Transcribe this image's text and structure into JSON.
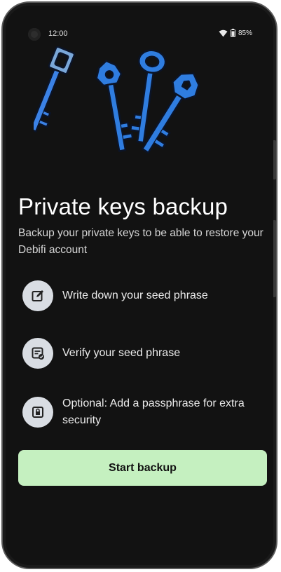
{
  "status_bar": {
    "time": "12:00",
    "battery": "85%",
    "icons": [
      "camera-icon",
      "wifi-icon",
      "battery-icon"
    ]
  },
  "hero": {
    "illustration": "keys-illustration",
    "accent_color": "#2f7de0",
    "outline_color": "#0e1a33"
  },
  "header": {
    "title": "Private keys backup",
    "subtitle": "Backup your private keys to be able to restore your Debifi account"
  },
  "steps": [
    {
      "icon": "edit-icon",
      "label": "Write down your seed phrase"
    },
    {
      "icon": "verify-document-icon",
      "label": "Verify your seed phrase"
    },
    {
      "icon": "lock-icon",
      "label": "Optional: Add a passphrase for extra security"
    }
  ],
  "actions": {
    "start_label": "Start backup",
    "button_color": "#c5f0c0"
  }
}
